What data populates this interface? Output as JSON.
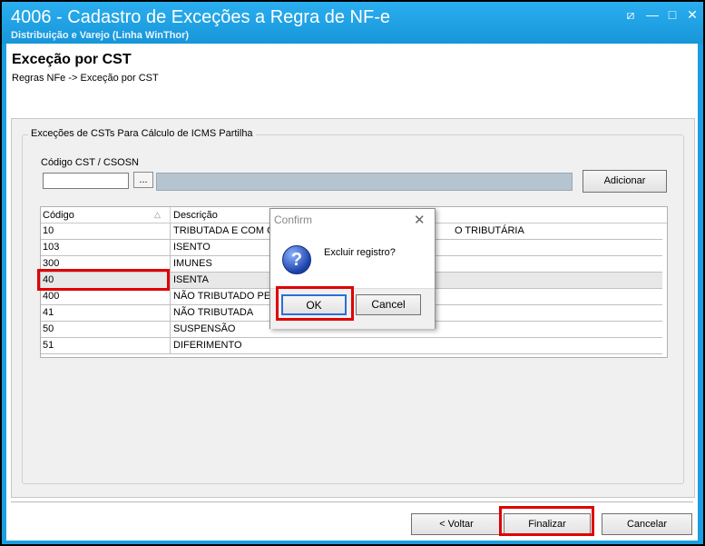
{
  "window": {
    "title": "4006 - Cadastro de Exceções a Regra de NF-e",
    "subtitle": "Distribuição e Varejo (Linha WinThor)",
    "minimize_glyph": "⧄",
    "restore_glyph": "—",
    "maximize_glyph": "□",
    "close_glyph": "✕"
  },
  "header": {
    "title": "Exceção por CST",
    "breadcrumb": "Regras NFe -> Exceção por CST"
  },
  "group": {
    "legend": "Exceções de CSTs Para Cálculo de ICMS Partilha",
    "cst_label": "Código CST / CSOSN",
    "cst_value": "",
    "lookup_label": "...",
    "add_label": "Adicionar"
  },
  "grid": {
    "columns": {
      "code": "Código",
      "desc": "Descrição"
    },
    "sort_glyph": "△",
    "rows": [
      {
        "code": "10",
        "desc": "TRIBUTADA E COM CO"
      },
      {
        "code": "103",
        "desc": "ISENTO"
      },
      {
        "code": "300",
        "desc": "IMUNES"
      },
      {
        "code": "40",
        "desc": "ISENTA"
      },
      {
        "code": "400",
        "desc": "NÃO TRIBUTADO PELO"
      },
      {
        "code": "41",
        "desc": "NÃO TRIBUTADA"
      },
      {
        "code": "50",
        "desc": "SUSPENSÃO"
      },
      {
        "code": "51",
        "desc": "DIFERIMENTO"
      }
    ],
    "row1_desc_tail": "O TRIBUTÁRIA"
  },
  "footer": {
    "back": "< Voltar",
    "finish": "Finalizar",
    "cancel": "Cancelar"
  },
  "dialog": {
    "title": "Confirm",
    "close_glyph": "✕",
    "icon_glyph": "?",
    "message": "Excluir registro?",
    "ok": "OK",
    "cancel": "Cancel"
  },
  "colors": {
    "titlebar": "#1b9fe0",
    "highlight": "#e00000"
  }
}
